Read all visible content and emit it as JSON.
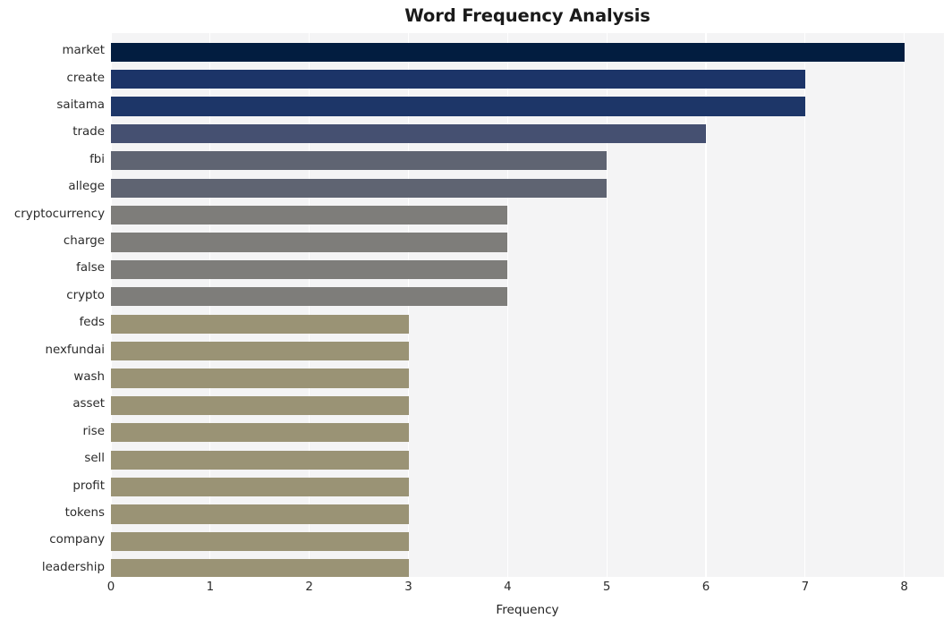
{
  "chart_data": {
    "type": "bar",
    "orientation": "horizontal",
    "title": "Word Frequency Analysis",
    "xlabel": "Frequency",
    "ylabel": "",
    "xlim": [
      0,
      8.4
    ],
    "ylim": [
      0,
      20
    ],
    "grid": true,
    "legend": null,
    "xticks": [
      "0",
      "1",
      "2",
      "3",
      "4",
      "5",
      "6",
      "7",
      "8"
    ],
    "xtick_values": [
      0,
      1,
      2,
      3,
      4,
      5,
      6,
      7,
      8
    ],
    "categories": [
      "market",
      "create",
      "saitama",
      "trade",
      "fbi",
      "allege",
      "cryptocurrency",
      "charge",
      "false",
      "crypto",
      "feds",
      "nexfundai",
      "wash",
      "asset",
      "rise",
      "sell",
      "profit",
      "tokens",
      "company",
      "leadership"
    ],
    "values": [
      8,
      7,
      7,
      6,
      5,
      5,
      4,
      4,
      4,
      4,
      3,
      3,
      3,
      3,
      3,
      3,
      3,
      3,
      3,
      3
    ],
    "bar_colors": [
      "#021d40",
      "#1c3468",
      "#1d3668",
      "#455071",
      "#5f6472",
      "#5f6472",
      "#7e7d7a",
      "#7e7d7a",
      "#7e7d7a",
      "#7e7d7a",
      "#9a9375",
      "#9a9375",
      "#9a9375",
      "#9a9375",
      "#9a9375",
      "#9a9375",
      "#9a9375",
      "#9a9375",
      "#9a9375",
      "#9a9375"
    ]
  },
  "style": {
    "figure_background": "#ffffff",
    "plot_background": "#f4f4f5",
    "gridline_color": "#ffffff",
    "title_color": "#1a1a1a",
    "tick_label_color": "#2b2b2b"
  }
}
